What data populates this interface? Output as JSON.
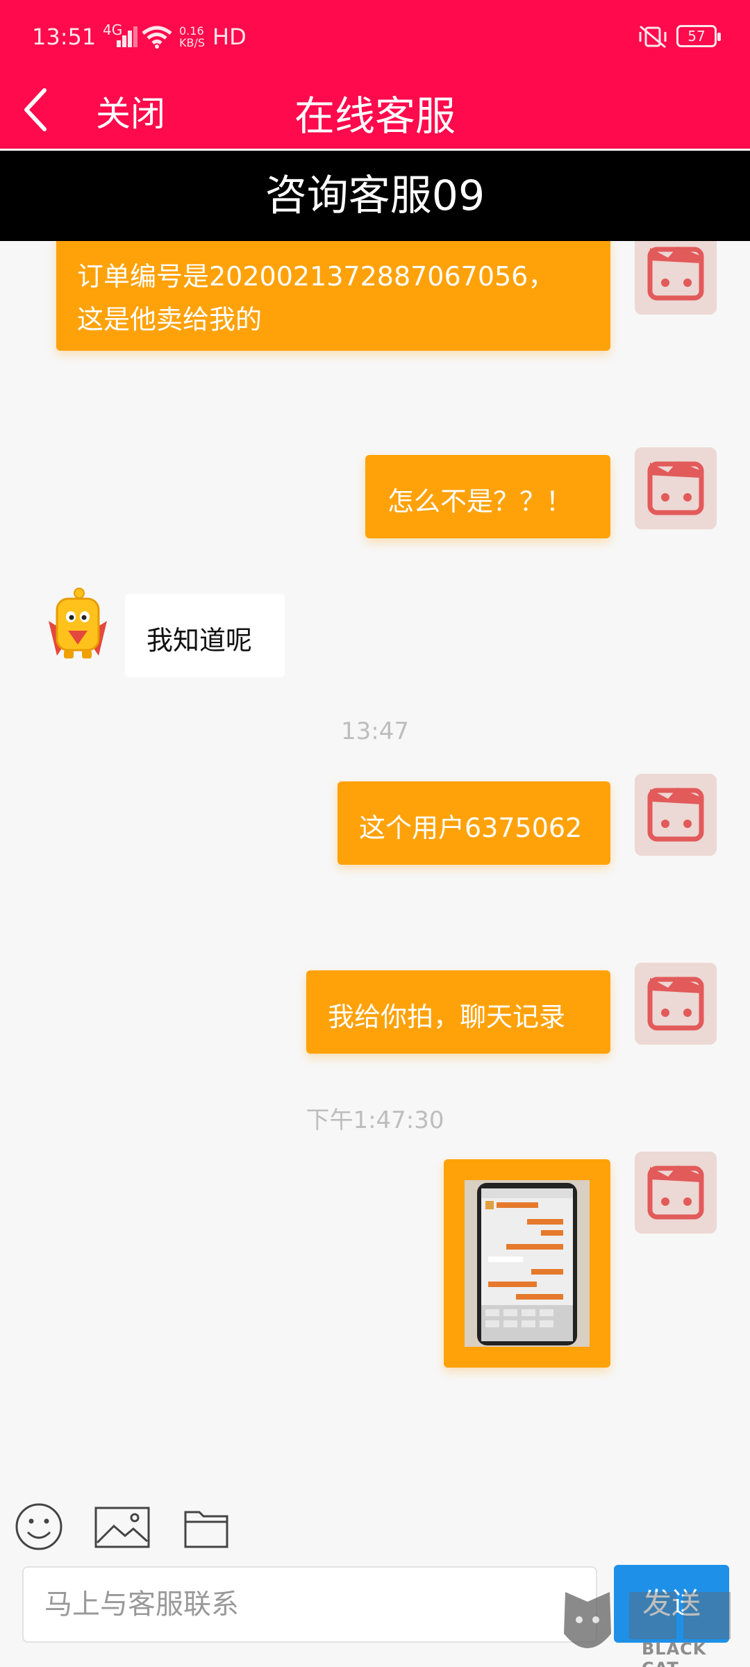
{
  "status_bar": {
    "time": "13:51",
    "signal_type": "4G",
    "net_speed_value": "0.16",
    "net_speed_unit": "KB/S",
    "hd_label": "HD",
    "battery": "57"
  },
  "header": {
    "close_label": "关闭",
    "title": "在线客服",
    "agent_name": "咨询客服09",
    "accent_color": "#ff0a4c"
  },
  "messages": [
    {
      "direction": "sent",
      "lines": [
        "订单编号是20200213728870670​56，",
        "这是他卖给我的"
      ]
    },
    {
      "direction": "sent",
      "text": "怎么不是？？！"
    },
    {
      "direction": "received",
      "text": "我知道呢"
    },
    {
      "timestamp": "13:47"
    },
    {
      "direction": "sent",
      "text": "这个用户6375062"
    },
    {
      "direction": "sent",
      "text": "我给你拍，聊天记录"
    },
    {
      "timestamp": "下午1:47:30"
    },
    {
      "direction": "sent",
      "type": "image"
    }
  ],
  "composer": {
    "placeholder": "马上与客服联系",
    "send_label": "发送",
    "send_color": "#1e90e8"
  },
  "watermark": {
    "text": "BLACK CAT"
  },
  "bubble_color": "#ffa20a"
}
